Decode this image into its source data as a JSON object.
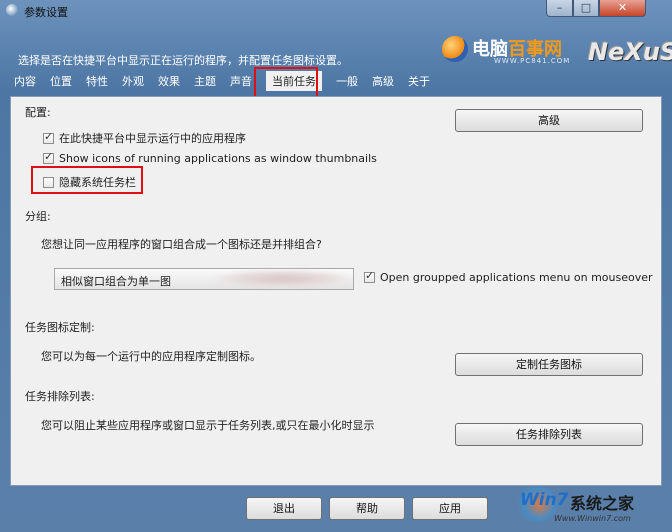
{
  "window": {
    "title": "参数设置",
    "min_glyph": "–",
    "max_glyph": "□",
    "close_glyph": "✕"
  },
  "header": {
    "description": "选择是否在快捷平台中显示正在运行的程序，并配置任务图标设置。",
    "logo_brand_1": "电脑",
    "logo_brand_2": "百事网",
    "logo_url": "WWW.PC841.COM",
    "logo_nexus": "NeXuS"
  },
  "tabs": [
    {
      "label": "内容"
    },
    {
      "label": "位置"
    },
    {
      "label": "特性"
    },
    {
      "label": "外观"
    },
    {
      "label": "效果"
    },
    {
      "label": "主题"
    },
    {
      "label": "声音"
    },
    {
      "label": "当前任务",
      "active": true
    },
    {
      "label": "一般"
    },
    {
      "label": "高级"
    },
    {
      "label": "关于"
    }
  ],
  "config": {
    "heading": "配置:",
    "advanced_button": "高级",
    "checkboxes": [
      {
        "label": "在此快捷平台中显示运行中的应用程序",
        "checked": true
      },
      {
        "label": "Show icons of running applications as window thumbnails",
        "checked": true
      },
      {
        "label": "隐藏系统任务栏",
        "checked": false
      }
    ]
  },
  "grouping": {
    "heading": "分组:",
    "question": "您想让同一应用程序的窗口组合成一个图标还是并排组合?",
    "select_value": "相似窗口组合为单一图",
    "mouseover_checkbox": {
      "label": "Open groupped applications menu on mouseover",
      "checked": true
    }
  },
  "task_icon": {
    "heading": "任务图标定制:",
    "description": "您可以为每一个运行中的应用程序定制图标。",
    "button": "定制任务图标"
  },
  "exclusion": {
    "heading": "任务排除列表:",
    "description": "您可以阻止某些应用程序或窗口显示于任务列表,或只在最小化时显示",
    "button": "任务排除列表"
  },
  "footer": {
    "exit_button": "退出",
    "help_button": "帮助",
    "apply_button": "应用",
    "watermark_win": "Win7",
    "watermark_cn": "系统之家",
    "watermark_url": "Www.Winwin7.com"
  }
}
